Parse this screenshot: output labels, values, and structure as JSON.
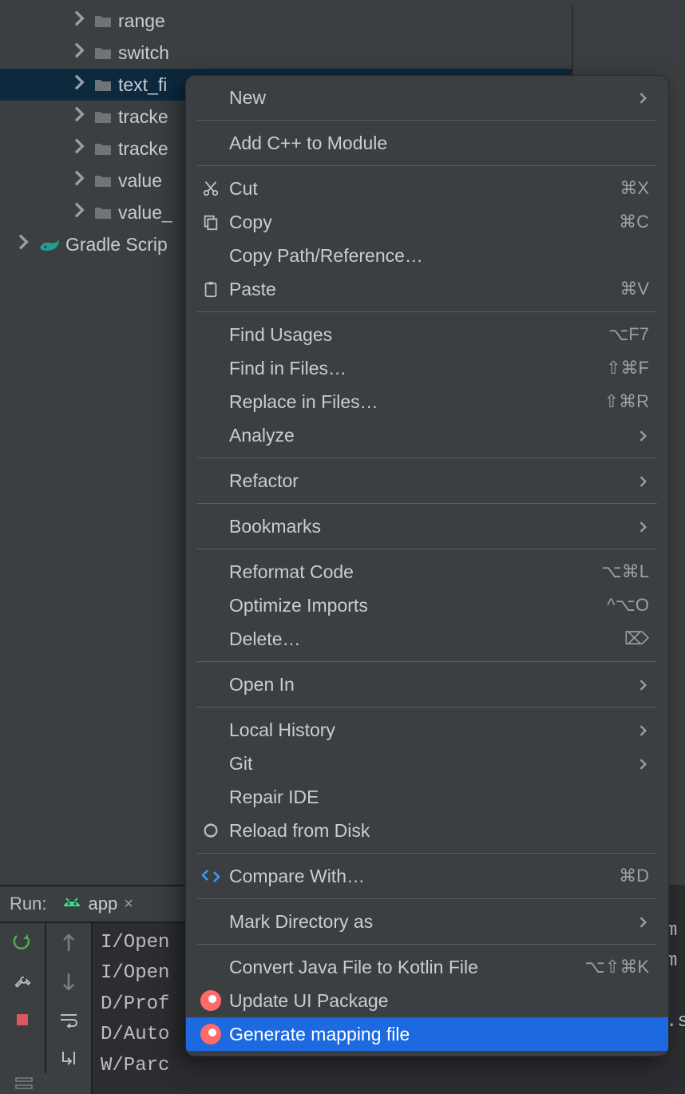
{
  "tree": {
    "items": [
      {
        "label": "range",
        "depth": 1,
        "icon": "folder",
        "selected": false
      },
      {
        "label": "switch",
        "depth": 1,
        "icon": "folder",
        "selected": false
      },
      {
        "label": "text_fi",
        "depth": 1,
        "icon": "folder",
        "selected": true
      },
      {
        "label": "tracke",
        "depth": 1,
        "icon": "folder",
        "selected": false
      },
      {
        "label": "tracke",
        "depth": 1,
        "icon": "folder",
        "selected": false
      },
      {
        "label": "value",
        "depth": 1,
        "icon": "folder",
        "selected": false
      },
      {
        "label": "value_",
        "depth": 1,
        "icon": "folder",
        "selected": false
      },
      {
        "label": "Gradle Scrip",
        "depth": 0,
        "icon": "gradle",
        "selected": false
      }
    ]
  },
  "run": {
    "label": "Run:",
    "tab_name": "app",
    "close_glyph": "×",
    "log_lines": [
      "I/Open",
      "I/Open",
      "D/Prof",
      "D/Auto",
      "W/Parc"
    ],
    "editor_peek_lines": [
      "m",
      "m",
      "",
      ".s",
      ""
    ]
  },
  "context_menu": {
    "items": [
      {
        "kind": "item",
        "icon": "",
        "label": "New",
        "shortcut": "",
        "submenu": true
      },
      {
        "kind": "sep"
      },
      {
        "kind": "item",
        "icon": "",
        "label": "Add C++ to Module",
        "shortcut": ""
      },
      {
        "kind": "sep"
      },
      {
        "kind": "item",
        "icon": "cut",
        "label": "Cut",
        "shortcut": "⌘X"
      },
      {
        "kind": "item",
        "icon": "copy",
        "label": "Copy",
        "shortcut": "⌘C"
      },
      {
        "kind": "item",
        "icon": "",
        "label": "Copy Path/Reference…",
        "shortcut": ""
      },
      {
        "kind": "item",
        "icon": "paste",
        "label": "Paste",
        "shortcut": "⌘V"
      },
      {
        "kind": "sep"
      },
      {
        "kind": "item",
        "icon": "",
        "label": "Find Usages",
        "shortcut": "⌥F7"
      },
      {
        "kind": "item",
        "icon": "",
        "label": "Find in Files…",
        "shortcut": "⇧⌘F"
      },
      {
        "kind": "item",
        "icon": "",
        "label": "Replace in Files…",
        "shortcut": "⇧⌘R"
      },
      {
        "kind": "item",
        "icon": "",
        "label": "Analyze",
        "shortcut": "",
        "submenu": true
      },
      {
        "kind": "sep"
      },
      {
        "kind": "item",
        "icon": "",
        "label": "Refactor",
        "shortcut": "",
        "submenu": true
      },
      {
        "kind": "sep"
      },
      {
        "kind": "item",
        "icon": "",
        "label": "Bookmarks",
        "shortcut": "",
        "submenu": true
      },
      {
        "kind": "sep"
      },
      {
        "kind": "item",
        "icon": "",
        "label": "Reformat Code",
        "shortcut": "⌥⌘L"
      },
      {
        "kind": "item",
        "icon": "",
        "label": "Optimize Imports",
        "shortcut": "^⌥O"
      },
      {
        "kind": "item",
        "icon": "",
        "label": "Delete…",
        "shortcut": "⌦"
      },
      {
        "kind": "sep"
      },
      {
        "kind": "item",
        "icon": "",
        "label": "Open In",
        "shortcut": "",
        "submenu": true
      },
      {
        "kind": "sep"
      },
      {
        "kind": "item",
        "icon": "",
        "label": "Local History",
        "shortcut": "",
        "submenu": true
      },
      {
        "kind": "item",
        "icon": "",
        "label": "Git",
        "shortcut": "",
        "submenu": true
      },
      {
        "kind": "item",
        "icon": "",
        "label": "Repair IDE",
        "shortcut": ""
      },
      {
        "kind": "item",
        "icon": "reload",
        "label": "Reload from Disk",
        "shortcut": ""
      },
      {
        "kind": "sep"
      },
      {
        "kind": "item",
        "icon": "compare",
        "label": "Compare With…",
        "shortcut": "⌘D"
      },
      {
        "kind": "sep"
      },
      {
        "kind": "item",
        "icon": "",
        "label": "Mark Directory as",
        "shortcut": "",
        "submenu": true
      },
      {
        "kind": "sep"
      },
      {
        "kind": "item",
        "icon": "",
        "label": "Convert Java File to Kotlin File",
        "shortcut": "⌥⇧⌘K"
      },
      {
        "kind": "item",
        "icon": "figma",
        "label": "Update UI Package",
        "shortcut": ""
      },
      {
        "kind": "item",
        "icon": "figma",
        "label": "Generate mapping file",
        "shortcut": "",
        "highlighted": true
      }
    ]
  }
}
